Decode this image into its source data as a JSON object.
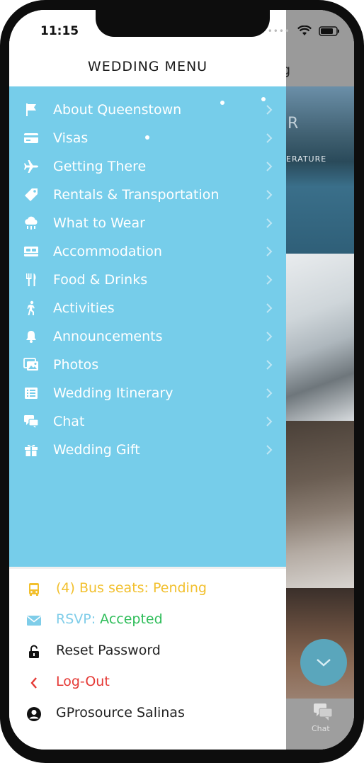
{
  "status_bar": {
    "time": "11:15"
  },
  "drawer": {
    "title": "WEDDING MENU",
    "menu_items": [
      {
        "label": "About Queenstown",
        "icon": "flag-icon"
      },
      {
        "label": "Visas",
        "icon": "credit-card-icon"
      },
      {
        "label": "Getting There",
        "icon": "airplane-icon"
      },
      {
        "label": "Rentals & Transportation",
        "icon": "tag-icon"
      },
      {
        "label": "What to Wear",
        "icon": "weather-cloud-icon"
      },
      {
        "label": "Accommodation",
        "icon": "bed-icon"
      },
      {
        "label": "Food & Drinks",
        "icon": "utensils-icon"
      },
      {
        "label": "Activities",
        "icon": "walking-icon"
      },
      {
        "label": "Announcements",
        "icon": "bell-icon"
      },
      {
        "label": "Photos",
        "icon": "photos-icon"
      },
      {
        "label": "Wedding Itinerary",
        "icon": "list-icon"
      },
      {
        "label": "Chat",
        "icon": "chat-icon"
      },
      {
        "label": "Wedding Gift",
        "icon": "gift-icon"
      }
    ],
    "bus": {
      "label": "(4) Bus seats: Pending",
      "icon": "bus-icon",
      "color": "#f2c02e"
    },
    "rsvp": {
      "label": "RSVP:",
      "value": "Accepted",
      "icon": "envelope-icon",
      "label_color": "#7fcde9",
      "value_color": "#2ebd59"
    },
    "reset_password": {
      "label": "Reset Password",
      "icon": "lock-icon"
    },
    "logout": {
      "label": "Log-Out",
      "icon": "chevron-left-icon",
      "color": "#e53935"
    },
    "user": {
      "label": "GProsource Salinas",
      "icon": "user-circle-icon"
    }
  },
  "background": {
    "header_text": "g",
    "image_text_1": "R",
    "image_text_2": "ERATURE",
    "tab_label": "Chat"
  },
  "colors": {
    "menu_bg": "#76cdea",
    "fab": "#5aa6bc"
  }
}
